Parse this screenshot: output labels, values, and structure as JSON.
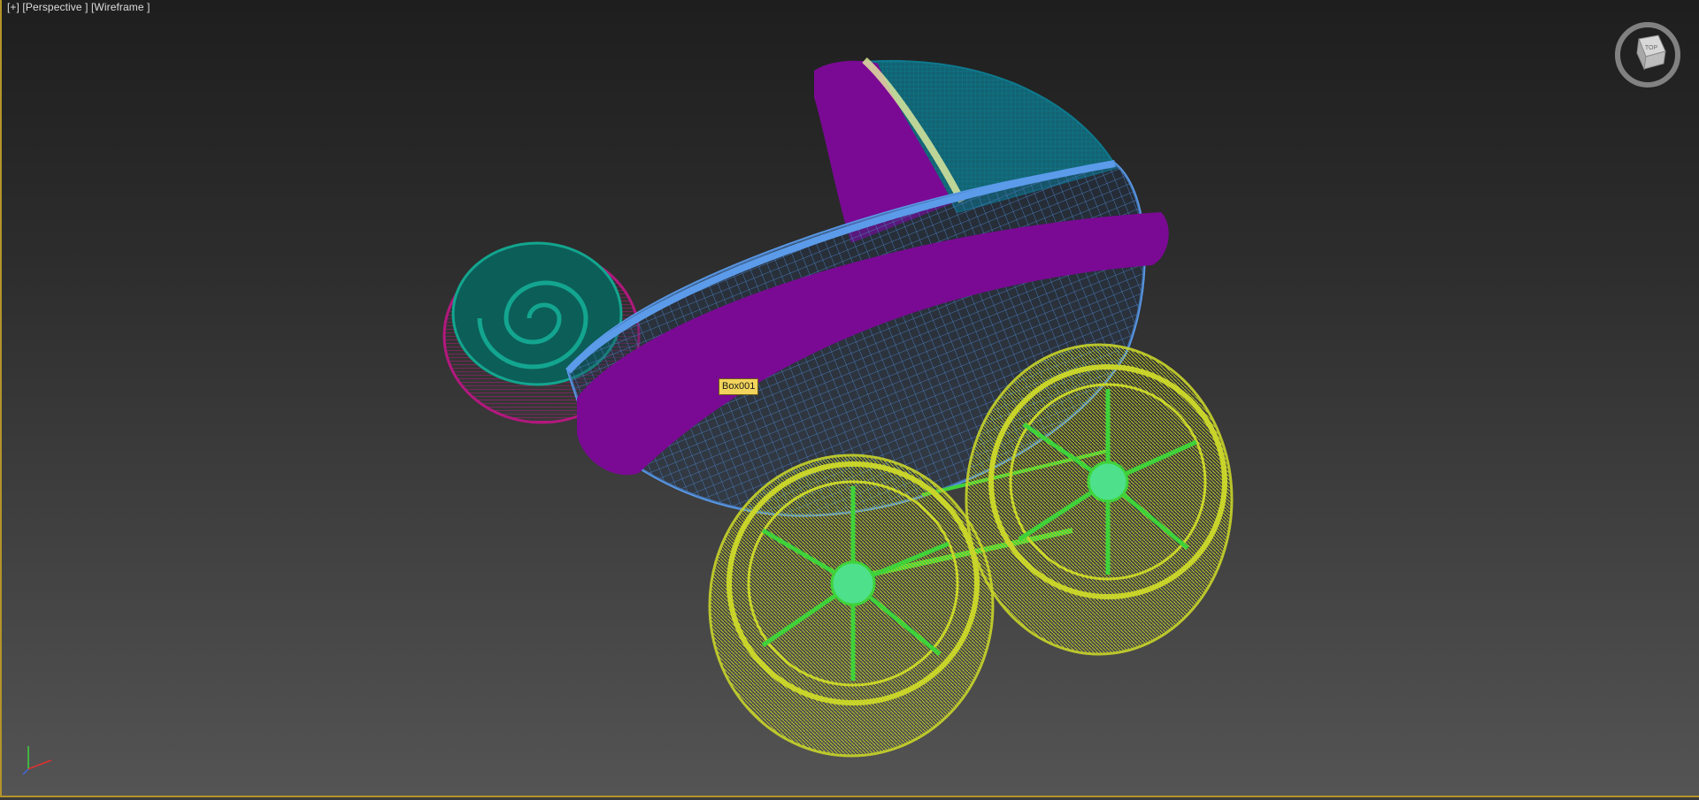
{
  "viewport": {
    "label_plus": "[+]",
    "label_view": "[Perspective ]",
    "label_mode": "[Wireframe ]"
  },
  "selection": {
    "tooltip": "Box001"
  },
  "viewcube": {
    "face_label": "TOP",
    "icon": "viewcube-icon"
  },
  "axis_tripod": {
    "icon": "axis-tripod-icon"
  },
  "colors": {
    "viewport_border": "#b3932a",
    "body_blue": "#5b9bea",
    "trim_purple": "#7a0a94",
    "hood_teal": "#0e7a8e",
    "handle_teal": "#13a58f",
    "handle_magenta": "#b3187e",
    "wheel_yellow": "#c8d42a",
    "spoke_green": "#3fd23a",
    "tooltip_bg": "#f2d35b"
  }
}
